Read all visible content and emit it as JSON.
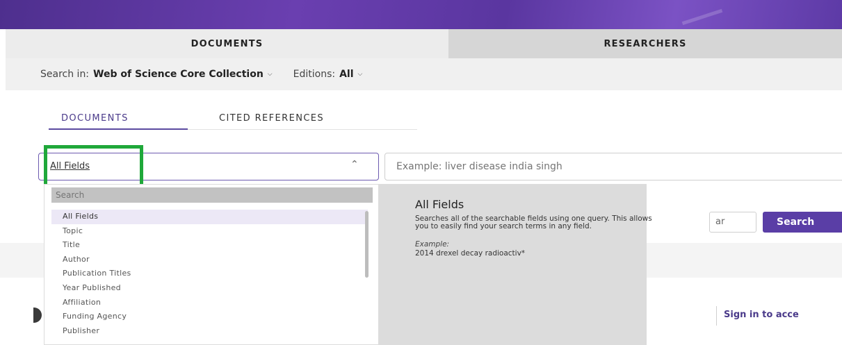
{
  "tabs": {
    "documents": "DOCUMENTS",
    "researchers": "RESEARCHERS"
  },
  "search_in": {
    "label": "Search in:",
    "value": "Web of Science Core Collection",
    "editions_label": "Editions:",
    "editions_value": "All"
  },
  "subtabs": {
    "documents": "DOCUMENTS",
    "cited": "CITED REFERENCES"
  },
  "field_select": {
    "value": "All Fields"
  },
  "query": {
    "placeholder": "Example: liver disease india singh"
  },
  "dropdown": {
    "search_placeholder": "Search",
    "items": [
      "All Fields",
      "Topic",
      "Title",
      "Author",
      "Publication Titles",
      "Year Published",
      "Affiliation",
      "Funding Agency",
      "Publisher"
    ]
  },
  "tooltip": {
    "title": "All Fields",
    "description": "Searches all of the searchable fields using one query. This allows you to easily find your search terms in any field.",
    "example_label": "Example:",
    "example": "2014 drexel decay radioactiv*"
  },
  "buttons": {
    "clear": "ar",
    "search": "Search"
  },
  "signin": "Sign in to acce",
  "colors": {
    "accent": "#5a3ea6",
    "highlight": "#1fa83a",
    "banner": "#5a36a0"
  }
}
